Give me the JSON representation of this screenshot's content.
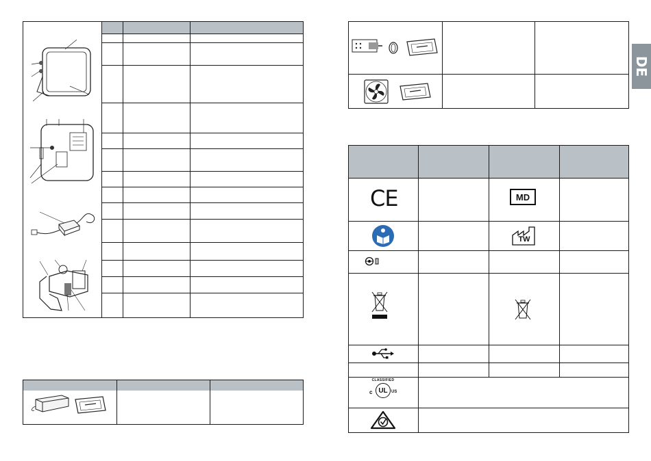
{
  "page": {
    "language_tab": "DE"
  },
  "symbols": {
    "ce": "CE",
    "md": "MD",
    "manufacture_country": "TW",
    "ul_top": "CLASSIFIED",
    "ul_mid": "UL",
    "ul_c": "c",
    "ul_us": "US"
  },
  "icons": {
    "monitor": "monitor-illustration",
    "monitor_back": "monitor-back-illustration",
    "adapter": "power-adapter-illustration",
    "clamp": "mount-clamp-illustration",
    "battery": "battery-illustration",
    "manual": "quick-guide-card-icon",
    "sensor": "sensor-module-icon",
    "ring": "ring-icon",
    "fan": "fan-icon",
    "manual_read": "read-manual-icon",
    "dc_polarity": "dc-polarity-icon",
    "weee_bar": "weee-bin-bar-icon",
    "weee": "weee-bin-icon",
    "usb": "usb-icon",
    "rcm": "rcm-mark-icon"
  }
}
